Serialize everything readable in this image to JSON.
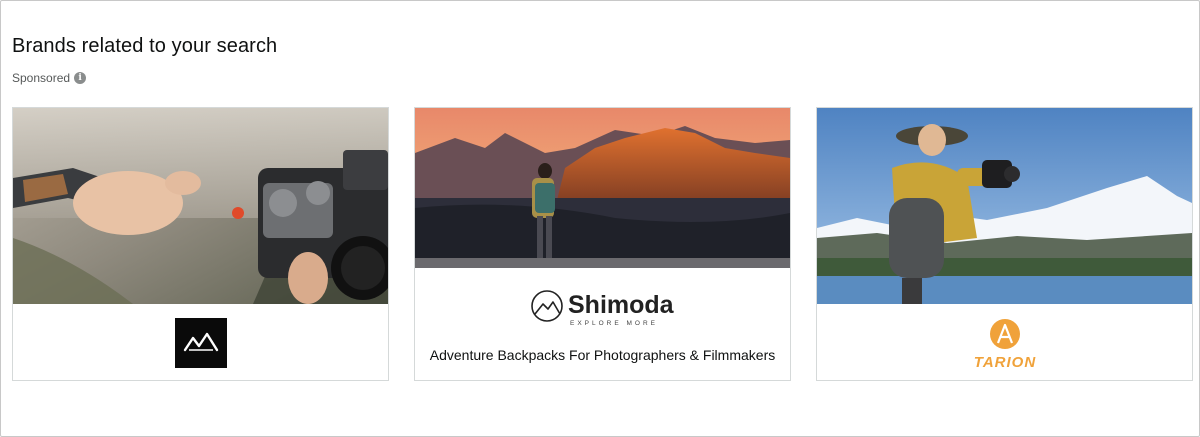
{
  "section": {
    "title": "Brands related to your search",
    "sponsored_label": "Sponsored",
    "info_icon_glyph": "i"
  },
  "cards": [
    {
      "brand_logo": "peak-design-logo",
      "image_subject": "camera-strap-photo"
    },
    {
      "brand_name": "Shimoda",
      "brand_subtitle": "EXPLORE MORE",
      "tagline": "Adventure Backpacks For Photographers & Filmmakers",
      "brand_logo": "shimoda-logo",
      "image_subject": "mountain-hiker-photo"
    },
    {
      "brand_name": "TARION",
      "brand_logo": "tarion-logo",
      "image_subject": "photographer-lake-photo"
    }
  ],
  "colors": {
    "tarion_orange": "#f0a23a",
    "border": "#d5d9d9",
    "text_primary": "#0f1111",
    "text_secondary": "#565959"
  }
}
